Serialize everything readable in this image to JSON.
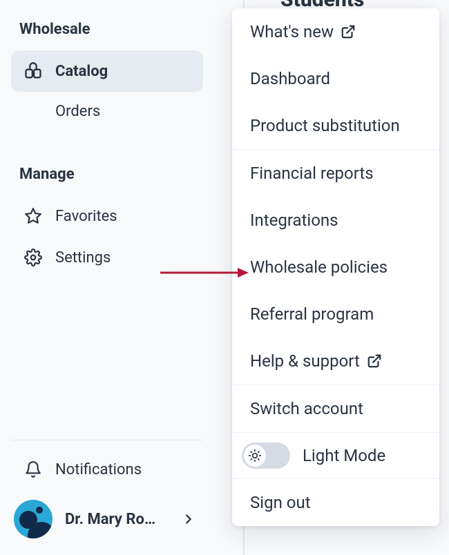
{
  "sidebar": {
    "sections": {
      "wholesale": {
        "title": "Wholesale",
        "items": {
          "catalog": "Catalog",
          "orders": "Orders"
        }
      },
      "manage": {
        "title": "Manage",
        "items": {
          "favorites": "Favorites",
          "settings": "Settings"
        }
      }
    },
    "notifications": "Notifications",
    "user": {
      "name": "Dr. Mary Ro…"
    }
  },
  "main": {
    "heading": "Students"
  },
  "dropdown": {
    "group1": {
      "whats_new": "What's new",
      "dashboard": "Dashboard",
      "product_substitution": "Product substitution"
    },
    "group2": {
      "financial_reports": "Financial reports",
      "integrations": "Integrations",
      "wholesale_policies": "Wholesale policies",
      "referral_program": "Referral program",
      "help_support": "Help & support"
    },
    "group3": {
      "switch_account": "Switch account"
    },
    "group4": {
      "mode_label": "Light Mode"
    },
    "group5": {
      "sign_out": "Sign out"
    }
  }
}
